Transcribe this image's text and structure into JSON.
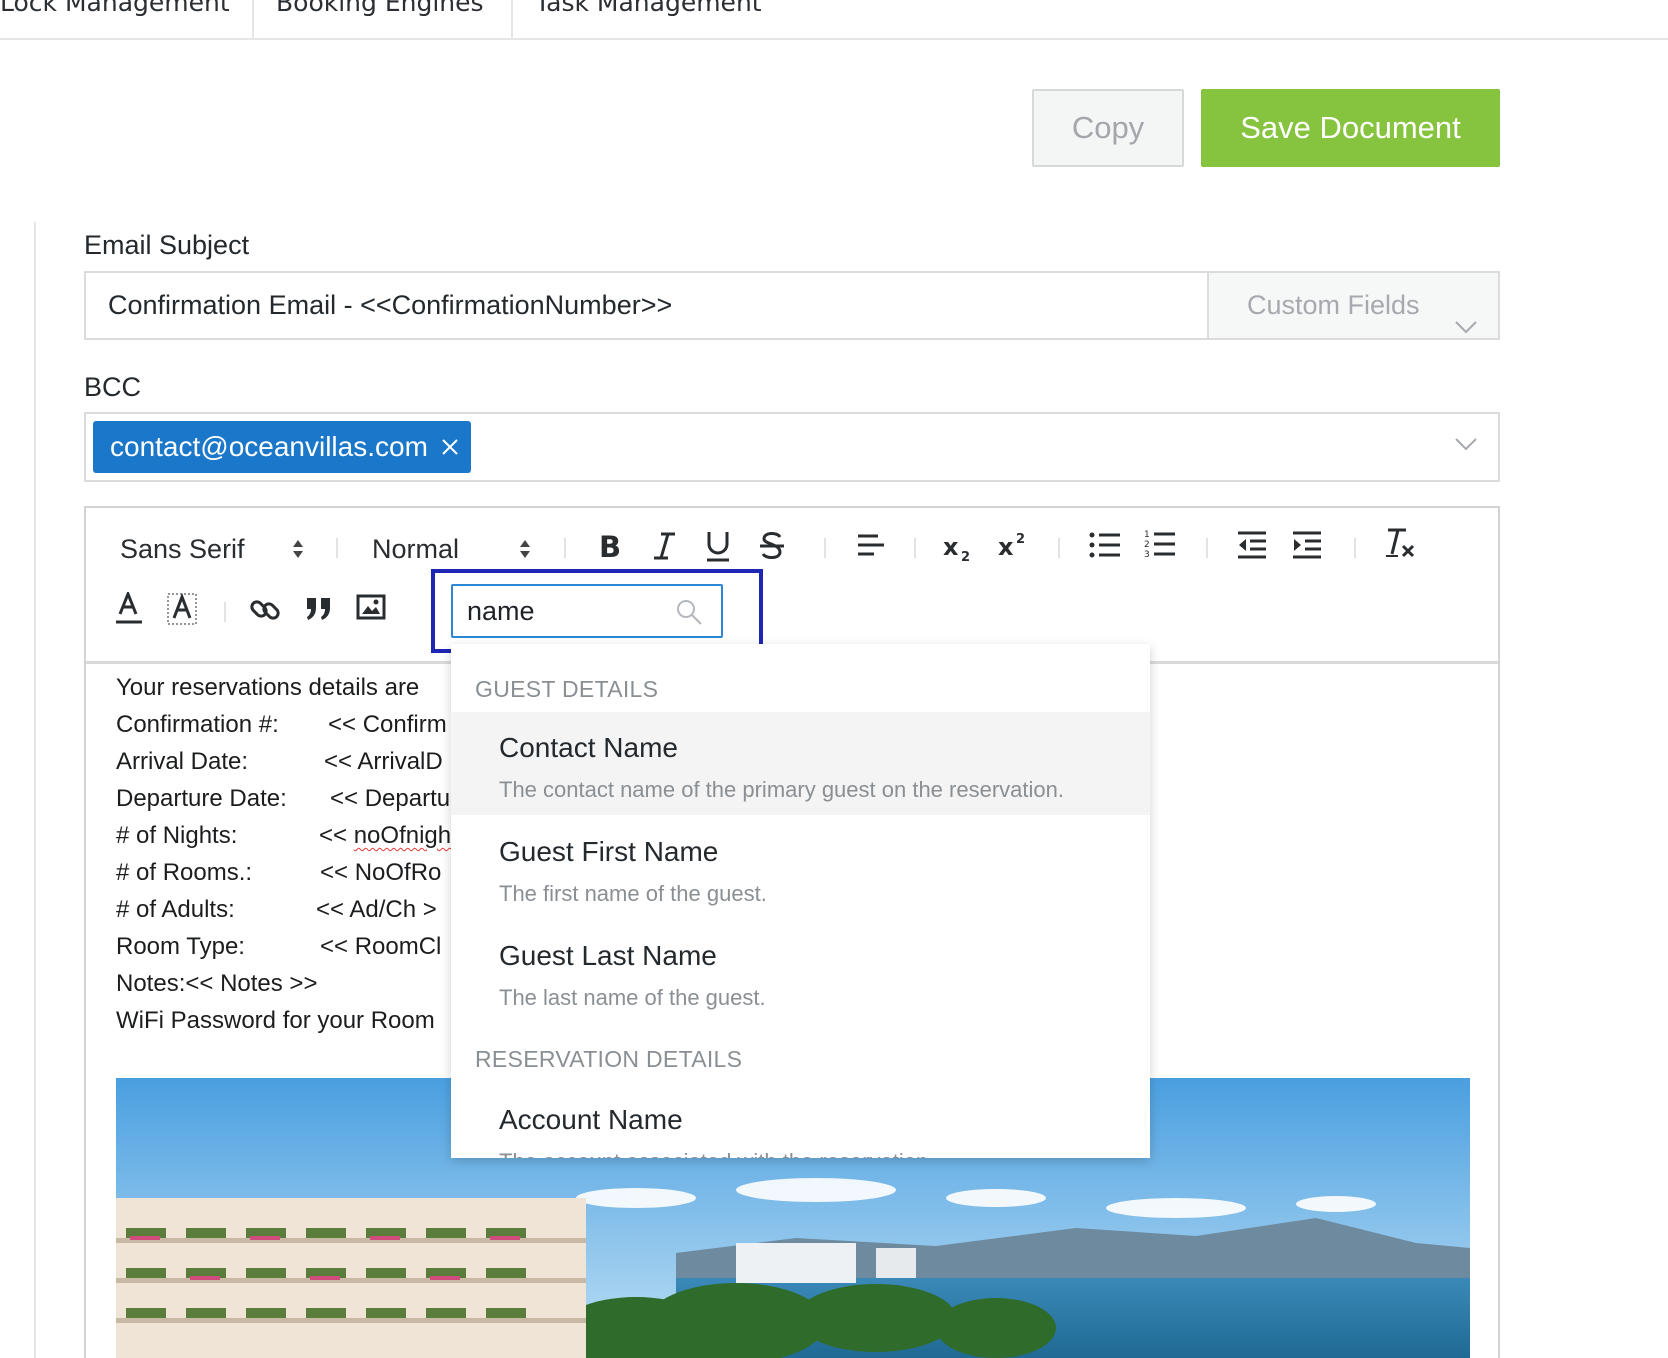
{
  "tabs": [
    {
      "label": "Lock Management"
    },
    {
      "label": "Booking Engines"
    },
    {
      "label": "Task Management"
    }
  ],
  "actions": {
    "copy_label": "Copy",
    "save_label": "Save Document",
    "save_color": "#86c440"
  },
  "subject": {
    "label": "Email Subject",
    "value": "Confirmation Email - <<ConfirmationNumber>>",
    "custom_fields_label": "Custom Fields"
  },
  "bcc": {
    "label": "BCC",
    "chips": [
      {
        "text": "contact@oceanvillas.com"
      }
    ],
    "chip_color": "#1a77c9"
  },
  "toolbar": {
    "font_family": "Sans Serif",
    "font_size": "Normal",
    "search_value": "name",
    "icons": [
      "bold-icon",
      "italic-icon",
      "underline-icon",
      "strike-icon",
      "align-icon",
      "subscript-icon",
      "superscript-icon",
      "bullet-list-icon",
      "ordered-list-icon",
      "outdent-icon",
      "indent-icon",
      "clear-format-icon",
      "text-color-icon",
      "background-color-icon",
      "link-icon",
      "quote-icon",
      "image-icon",
      "search-icon"
    ]
  },
  "body": {
    "lines": [
      {
        "label": "Your reservations details are",
        "value": ""
      },
      {
        "label": "Confirmation #:",
        "value": "<< Confirm"
      },
      {
        "label": "Arrival Date:",
        "value": "<< ArrivalD"
      },
      {
        "label": "Departure Date:",
        "value": "<< Departu"
      },
      {
        "label": "# of Nights:",
        "value_prefix": "<< ",
        "value": "noOfnigh"
      },
      {
        "label": "# of Rooms.:",
        "value": "<< NoOfRo"
      },
      {
        "label": "# of Adults:",
        "value": "<< Ad/Ch >"
      },
      {
        "label": "Room Type:",
        "value": "<< RoomCl"
      },
      {
        "label": "Notes:<< Notes >>",
        "value": ""
      },
      {
        "label": "WiFi Password for your Room",
        "value": ""
      }
    ]
  },
  "dropdown": {
    "groups": [
      {
        "title": "GUEST DETAILS",
        "items": [
          {
            "name": "Contact Name",
            "desc": "The contact name of the primary guest on the reservation."
          },
          {
            "name": "Guest First Name",
            "desc": "The first name of the guest."
          },
          {
            "name": "Guest Last Name",
            "desc": "The last name of the guest."
          }
        ]
      },
      {
        "title": "RESERVATION DETAILS",
        "items": [
          {
            "name": "Account Name",
            "desc": "The account associated with the reservation."
          }
        ]
      }
    ]
  }
}
